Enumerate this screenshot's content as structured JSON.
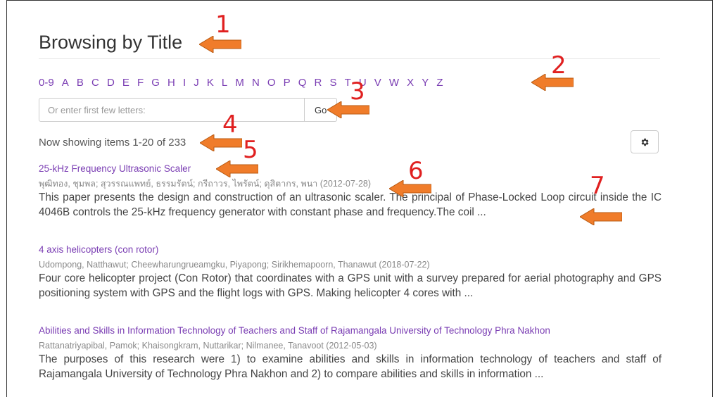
{
  "page": {
    "title": "Browsing by Title"
  },
  "alpha_nav": [
    "0-9",
    "A",
    "B",
    "C",
    "D",
    "E",
    "F",
    "G",
    "H",
    "I",
    "J",
    "K",
    "L",
    "M",
    "N",
    "O",
    "P",
    "Q",
    "R",
    "S",
    "T",
    "U",
    "V",
    "W",
    "X",
    "Y",
    "Z"
  ],
  "jump": {
    "placeholder": "Or enter first few letters:",
    "go_label": "Go"
  },
  "showing": "Now showing items 1-20 of 233",
  "settings_icon": "gear-icon",
  "items": [
    {
      "title": "25-kHz Frequency Ultrasonic Scaler",
      "meta": "พุฒิทอง, ชุมพล; สุวรรณแพทย์, ธรรมรัตน์; กรีถาวร, ไพรัตน์; ดุสิตากร, พนา (2012-07-28)",
      "abstract": "This paper presents the design and construction of an ultrasonic scaler. The principal of Phase-Locked Loop circuit inside the IC 4046B controls the 25-kHz frequency generator with constant phase and frequency.The coil ..."
    },
    {
      "title": "4 axis helicopters (con rotor)",
      "meta": "Udompong, Natthawut; Cheewharungrueamgku, Piyapong; Sirikhemapoorn, Thanawut (2018-07-22)",
      "abstract": "Four core helicopter project (Con Rotor) that coordinates with a GPS unit with a survey prepared for aerial photography and GPS positioning system with GPS and the flight logs with GPS. Making helicopter 4 cores with ..."
    },
    {
      "title": "Abilities and Skills in Information Technology of Teachers and Staff of Rajamangala University of Technology Phra Nakhon",
      "meta": "Rattanatriyapibal, Pamok; Khaisongkram, Nuttarikar; Nilmanee, Tanavoot (2012-05-03)",
      "abstract": "The purposes of this research were 1) to examine abilities and skills in information technology of teachers and staff of Rajamangala University of Technology Phra Nakhon and 2) to compare abilities and skills in information ..."
    }
  ],
  "annotations": [
    "1",
    "2",
    "3",
    "4",
    "5",
    "6",
    "7"
  ],
  "colors": {
    "link": "#7a3db3",
    "arrow": "#f07c2a",
    "annotation": "#e02020"
  }
}
